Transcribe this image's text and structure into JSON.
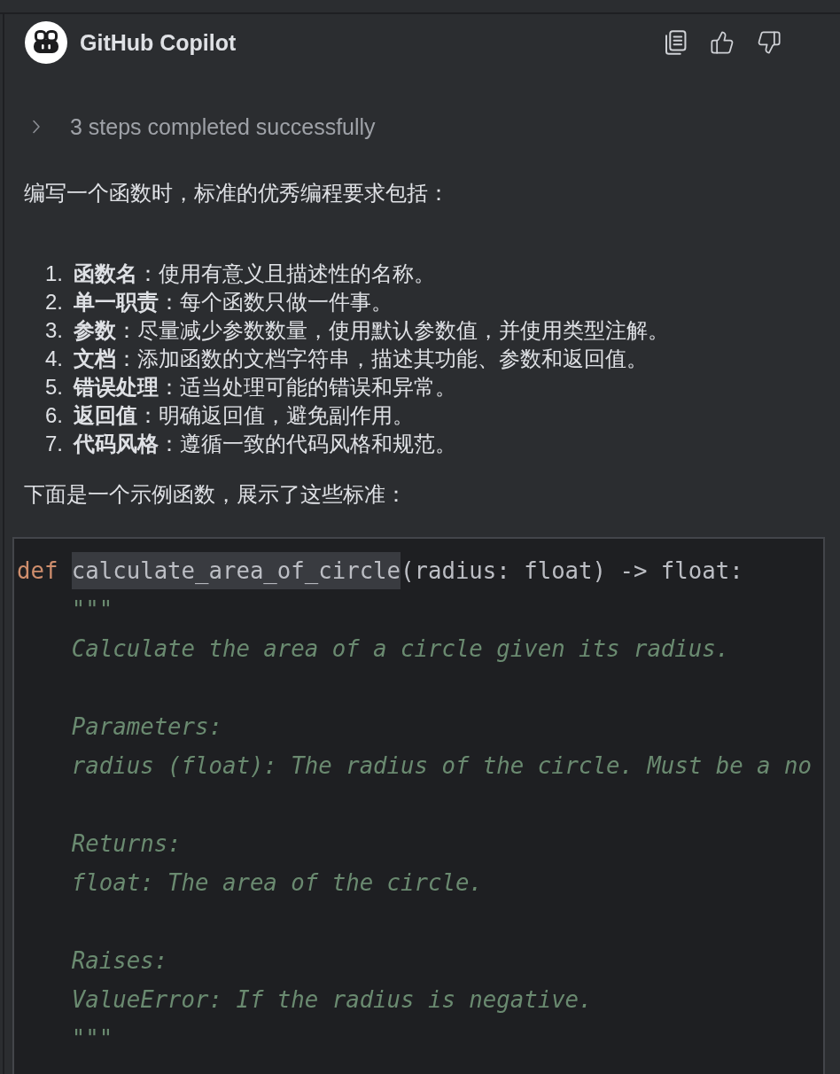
{
  "header": {
    "title": "GitHub Copilot",
    "actions": [
      {
        "kind": "copy"
      },
      {
        "kind": "thumbs_up"
      },
      {
        "kind": "thumbs_down"
      }
    ]
  },
  "steps": {
    "label": "3 steps completed successfully",
    "expanded": false
  },
  "intro": "编写一个函数时，标准的优秀编程要求包括：",
  "requirements": [
    {
      "marker": "1.",
      "text": "**函数名**：使用有意义且描述性的名称。"
    },
    {
      "marker": "2.",
      "text": "**单一职责**：每个函数只做一件事。"
    },
    {
      "marker": "3.",
      "text": "**参数**：尽量减少参数数量，使用默认参数值，并使用类型注解。"
    },
    {
      "marker": "4.",
      "text": "**文档**：添加函数的文档字符串，描述其功能、参数和返回值。"
    },
    {
      "marker": "5.",
      "text": "**错误处理**：适当处理可能的错误和异常。"
    },
    {
      "marker": "6.",
      "text": "**返回值**：明确返回值，避免副作用。"
    },
    {
      "marker": "7.",
      "text": "**代码风格**：遵循一致的代码风格和规范。"
    }
  ],
  "outro": "下面是一个示例函数，展示了这些标准：",
  "code": {
    "lines": [
      {
        "kind": "code",
        "tokens": [
          {
            "kind": "keyword",
            "text": "def",
            "highlighted": false
          },
          {
            "kind": "function",
            "text": "calculate_area_of_circle",
            "highlighted": true
          },
          {
            "kind": "plain",
            "text": "(radius: float) -> float:",
            "highlighted": false
          }
        ],
        "children": [
          {
            "kind": "docstring",
            "text": "\"\"\""
          },
          {
            "kind": "docstring",
            "text": "Calculate the area of a circle given its radius."
          },
          {
            "kind": "blank"
          },
          {
            "kind": "docstring",
            "text": "Parameters:"
          },
          {
            "kind": "docstring",
            "text": "radius (float): The radius of the circle. Must be a no"
          },
          {
            "kind": "blank"
          },
          {
            "kind": "docstring",
            "text": "Returns:"
          },
          {
            "kind": "docstring",
            "text": "float: The area of the circle."
          },
          {
            "kind": "blank"
          },
          {
            "kind": "docstring",
            "text": "Raises:"
          },
          {
            "kind": "docstring",
            "text": "ValueError: If the radius is negative."
          },
          {
            "kind": "docstring",
            "text": "\"\"\""
          }
        ]
      }
    ]
  }
}
